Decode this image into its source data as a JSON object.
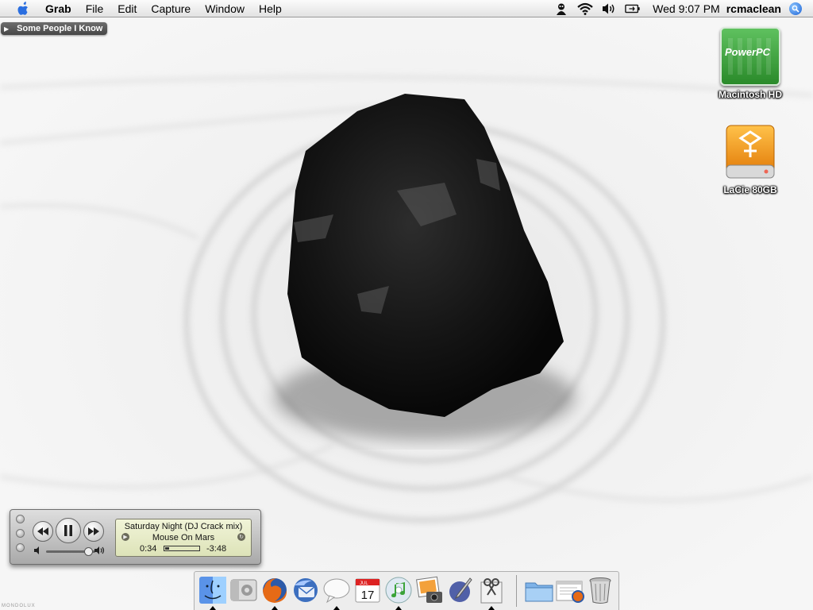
{
  "menubar": {
    "app_name": "Grab",
    "menus": [
      "File",
      "Edit",
      "Capture",
      "Window",
      "Help"
    ],
    "clock": "Wed 9:07 PM",
    "user": "rcmaclean",
    "status_icons": [
      "user-icon",
      "wifi-icon",
      "volume-icon",
      "battery-icon"
    ]
  },
  "pill_label": "Some People I Know",
  "desktop_icons": [
    {
      "label": "Macintosh HD",
      "badge": "PowerPC",
      "color": "#2a8a2a"
    },
    {
      "label": "LaCie 80GB",
      "color": "#f39a1c"
    }
  ],
  "player": {
    "track": "Saturday Night (DJ Crack mix)",
    "artist": "Mouse On Mars",
    "elapsed": "0:34",
    "remaining": "-3:48",
    "progress": 0.13,
    "volume": 0.85
  },
  "dock": {
    "apps": [
      {
        "icon": "finder-icon",
        "running": true
      },
      {
        "icon": "system-preferences-icon",
        "running": false
      },
      {
        "icon": "firefox-icon",
        "running": true
      },
      {
        "icon": "thunderbird-icon",
        "running": false
      },
      {
        "icon": "ichat-icon",
        "running": true
      },
      {
        "icon": "ical-icon",
        "running": false,
        "text": "17",
        "month": "JUL"
      },
      {
        "icon": "itunes-icon",
        "running": true
      },
      {
        "icon": "iphoto-icon",
        "running": false
      },
      {
        "icon": "script-editor-icon",
        "running": false
      },
      {
        "icon": "grab-icon",
        "running": true
      }
    ],
    "docs": [
      {
        "icon": "applications-folder-icon"
      },
      {
        "icon": "firefox-document-icon"
      },
      {
        "icon": "trash-icon"
      }
    ]
  },
  "credit": "MONDOLUX"
}
